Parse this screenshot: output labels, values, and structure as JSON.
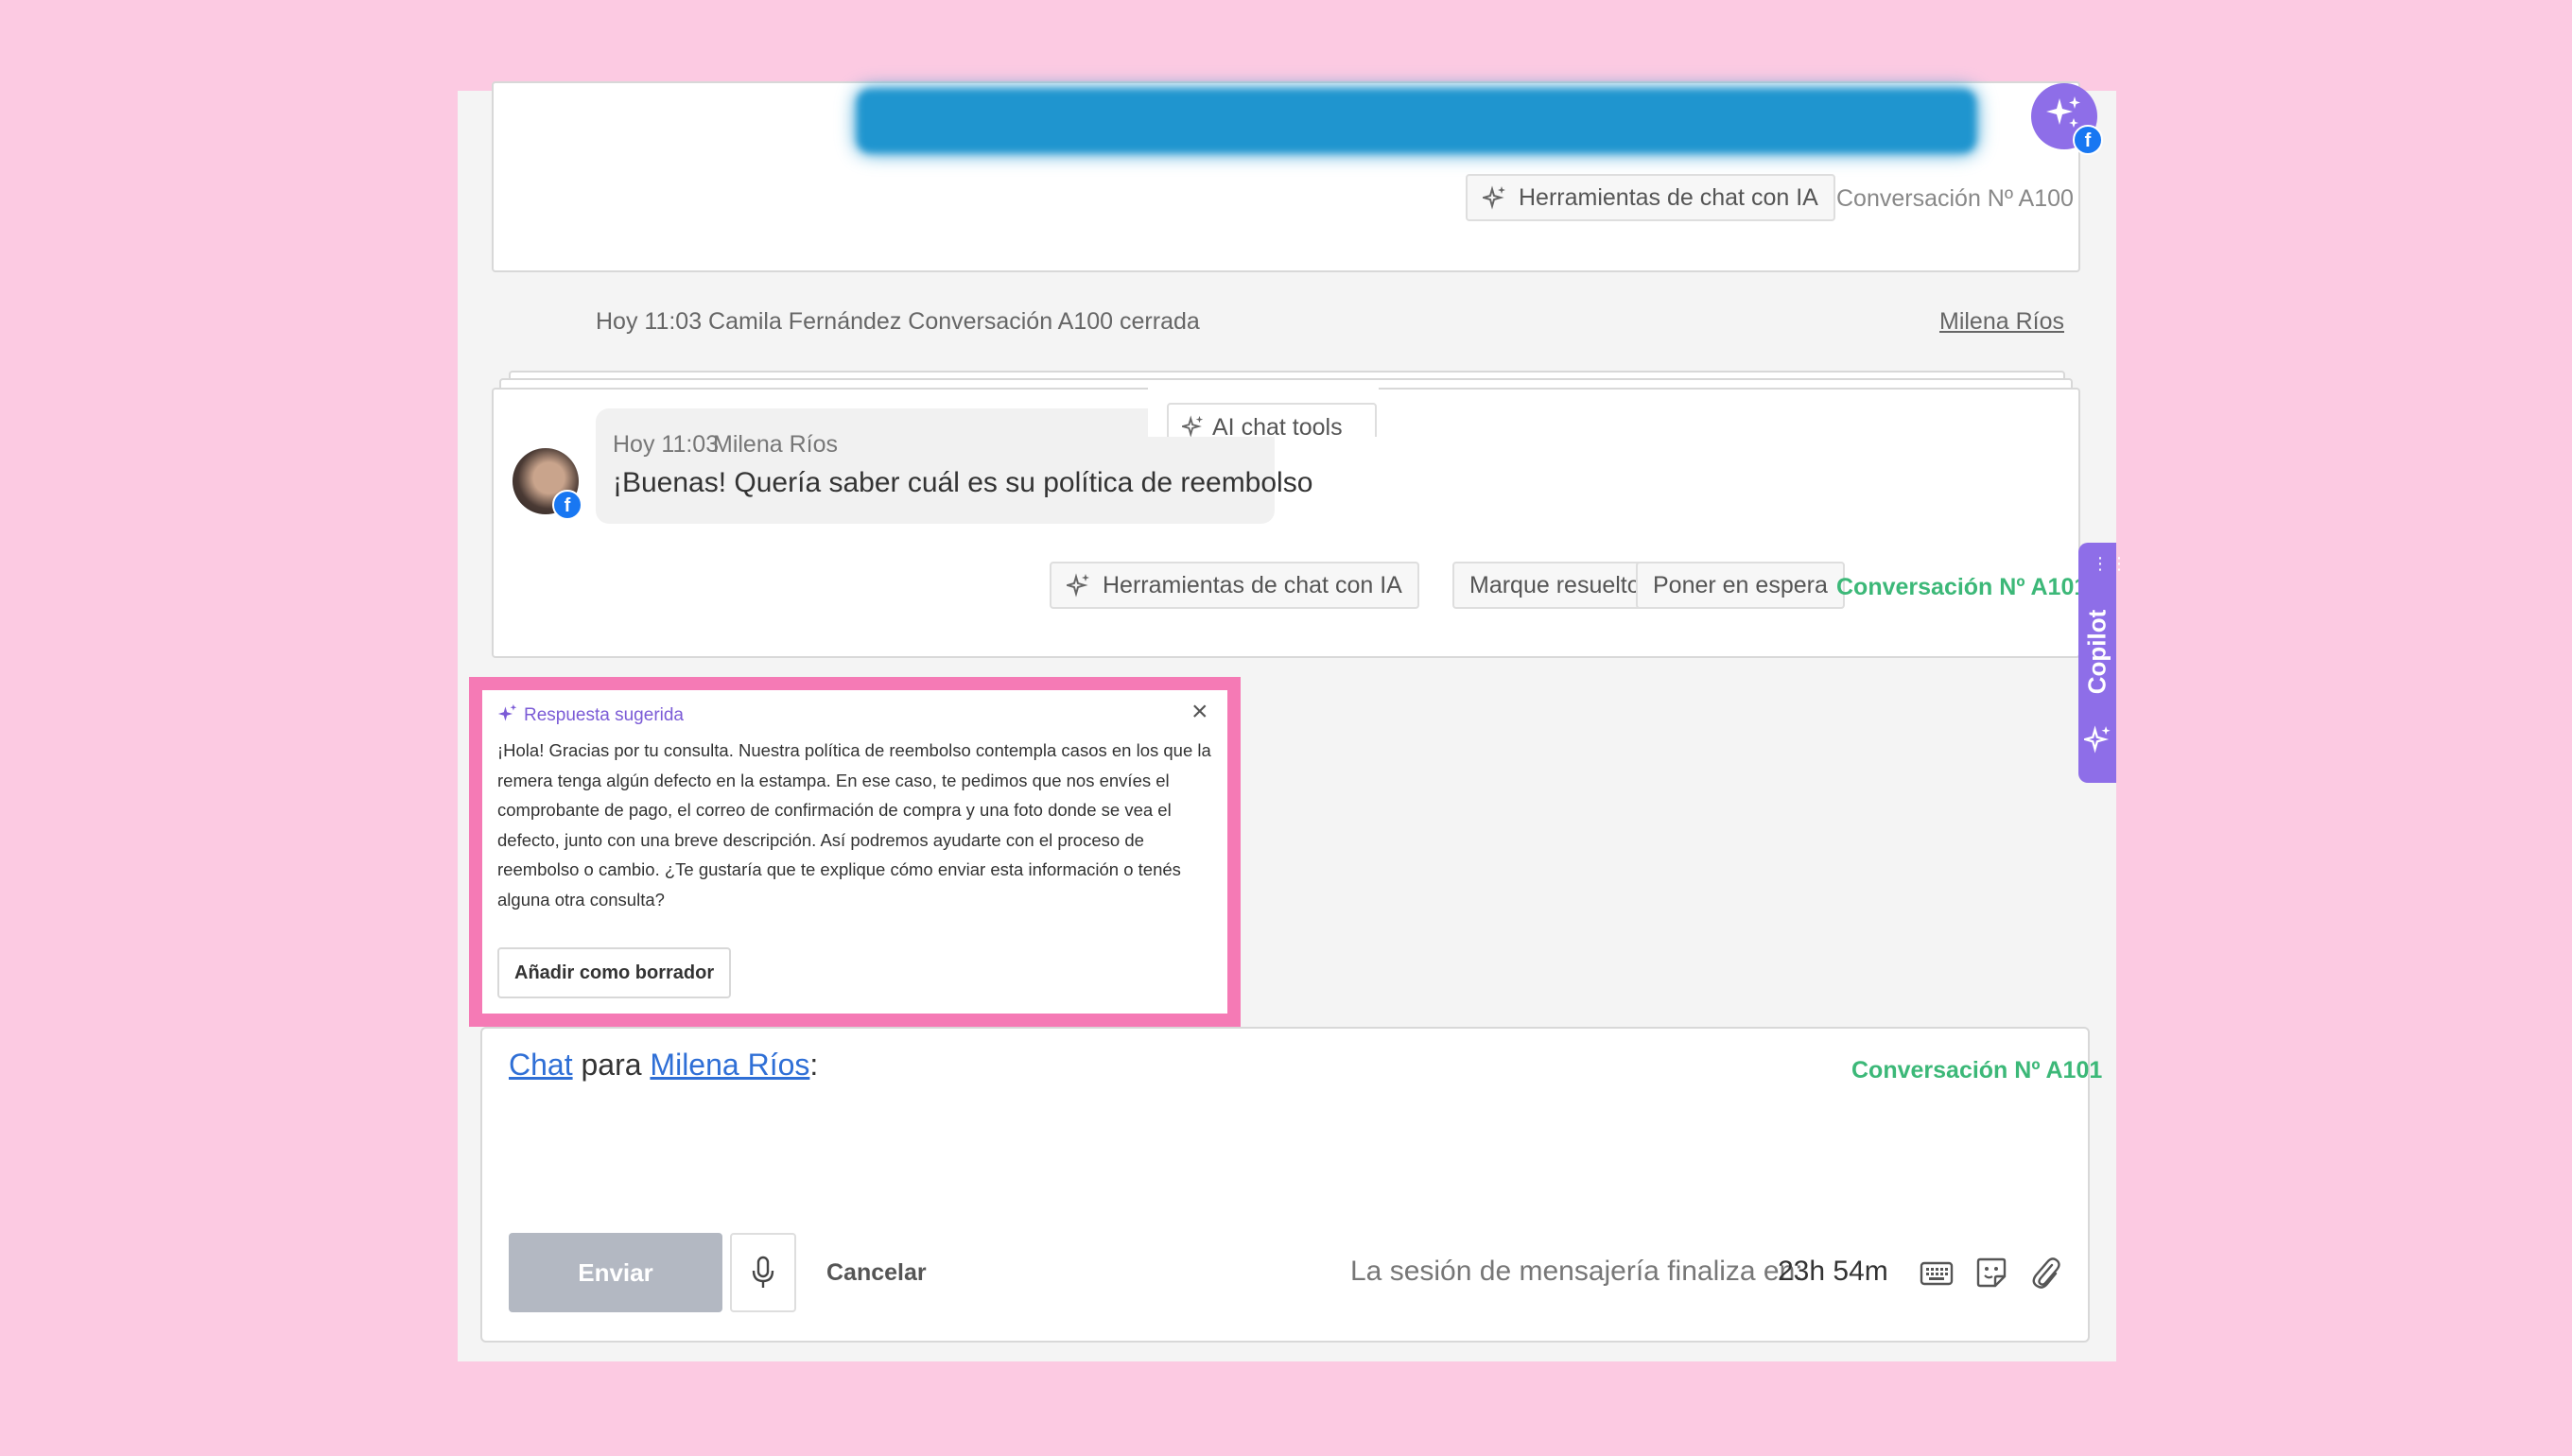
{
  "colors": {
    "background": "#fccae2",
    "highlight_border": "#f57ab5",
    "accent_purple": "#7b5bd6",
    "conversation_green": "#3cb878",
    "link_blue": "#2f6fd6",
    "send_disabled": "#b3b8c2"
  },
  "top_card": {
    "ai_tools_label": "Herramientas de chat con IA",
    "conversation_label": "Conversación Nº A100",
    "bot_avatar_icon": "sparkles-icon"
  },
  "system_event": {
    "text": "Hoy 11:03 Camila Fernández Conversación A100 cerrada",
    "assignee": "Milena Ríos"
  },
  "message_card": {
    "timestamp": "Hoy 11:03",
    "author": "Milena Ríos",
    "body": "¡Buenas! Quería saber cuál es su política de reembolso",
    "ai_chat_tools_tooltip": "AI chat tools",
    "ai_tools_label": "Herramientas de chat con IA",
    "mark_resolved_label": "Marque resuelto",
    "hold_label": "Poner en espera",
    "conversation_label": "Conversación Nº A101"
  },
  "suggestion": {
    "header": "Respuesta sugerida",
    "body": "¡Hola! Gracias por tu consulta. Nuestra política de reembolso contempla casos en los que la remera tenga algún defecto en la estampa. En ese caso, te pedimos que nos envíes el comprobante de pago, el correo de confirmación de compra y una foto donde se vea el defecto, junto con una breve descripción. Así podremos ayudarte con el proceso de reembolso o cambio. ¿Te gustaría que te explique cómo enviar esta información o tenés alguna otra consulta?",
    "add_draft_label": "Añadir como borrador",
    "close_glyph": "×"
  },
  "copilot": {
    "label": "Copilot"
  },
  "composer": {
    "channel": "Chat",
    "to_word": "para",
    "recipient": "Milena Ríos",
    "colon": ":",
    "conversation_label": "Conversación Nº A101",
    "send_label": "Enviar",
    "cancel_label": "Cancelar",
    "session_label": "La sesión de mensajería finaliza en:",
    "session_time": "23h 54m"
  }
}
